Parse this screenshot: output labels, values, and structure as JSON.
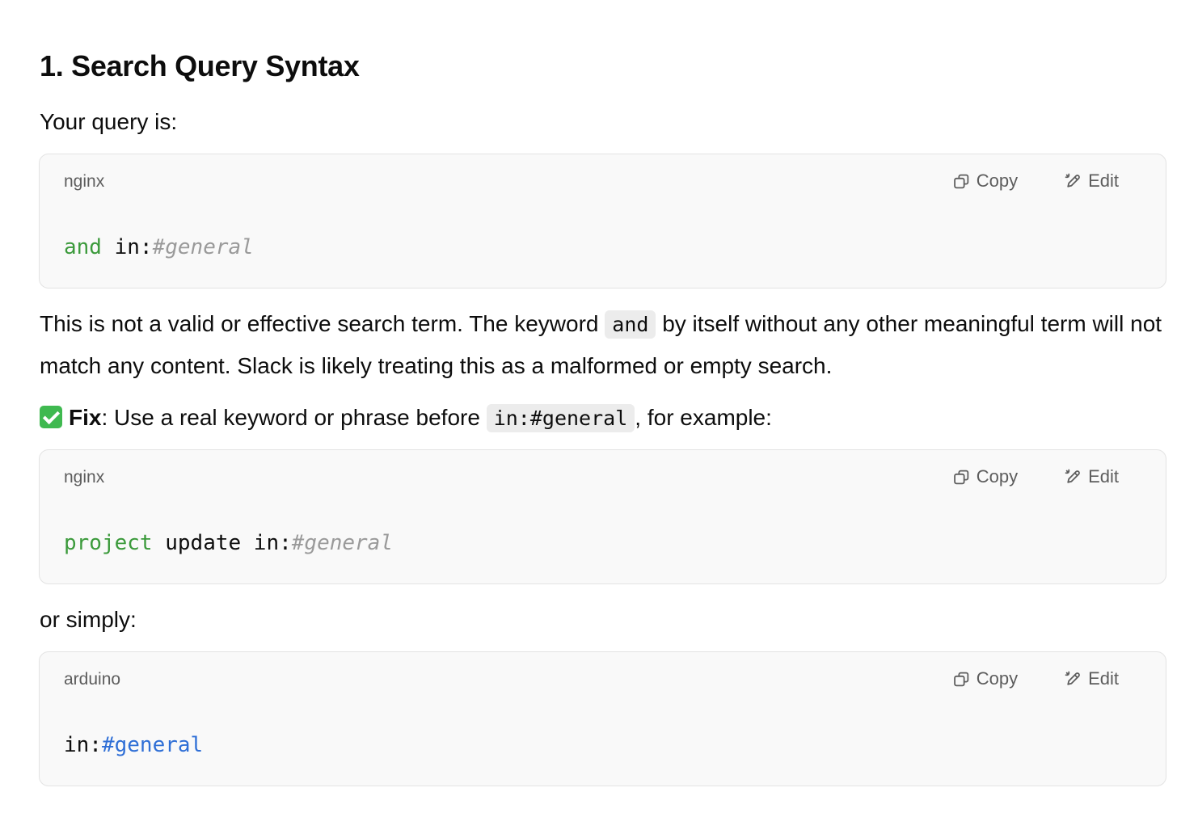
{
  "heading": "1. Search Query Syntax",
  "intro": "Your query is:",
  "blocks": [
    {
      "language": "nginx",
      "copy_label": "Copy",
      "edit_label": "Edit",
      "tokens": [
        {
          "text": "and",
          "style": "keyword"
        },
        {
          "text": " in:",
          "style": "plain"
        },
        {
          "text": "#general",
          "style": "comment"
        }
      ]
    },
    {
      "language": "nginx",
      "copy_label": "Copy",
      "edit_label": "Edit",
      "tokens": [
        {
          "text": "project",
          "style": "keyword"
        },
        {
          "text": " update in:",
          "style": "plain"
        },
        {
          "text": "#general",
          "style": "comment"
        }
      ]
    },
    {
      "language": "arduino",
      "copy_label": "Copy",
      "edit_label": "Edit",
      "tokens": [
        {
          "text": "in:",
          "style": "plain"
        },
        {
          "text": "#general",
          "style": "channel"
        }
      ]
    }
  ],
  "explanation": {
    "part1": "This is not a valid or effective search term. The keyword ",
    "code": "and",
    "part2": " by itself without any other meaningful term will not match any content. Slack is likely treating this as a malformed or empty search."
  },
  "fix": {
    "label": "Fix",
    "text1": ": Use a real keyword or phrase before ",
    "code": "in:#general",
    "text2": ", for example:"
  },
  "or_simply": "or simply:",
  "colors": {
    "keyword": "#3b9a3b",
    "comment": "#9a9a9a",
    "channel": "#2f6fd6",
    "check": "#3fb950"
  },
  "icons": {
    "copy": "copy-icon",
    "edit": "edit-icon",
    "check": "check-mark-icon"
  }
}
